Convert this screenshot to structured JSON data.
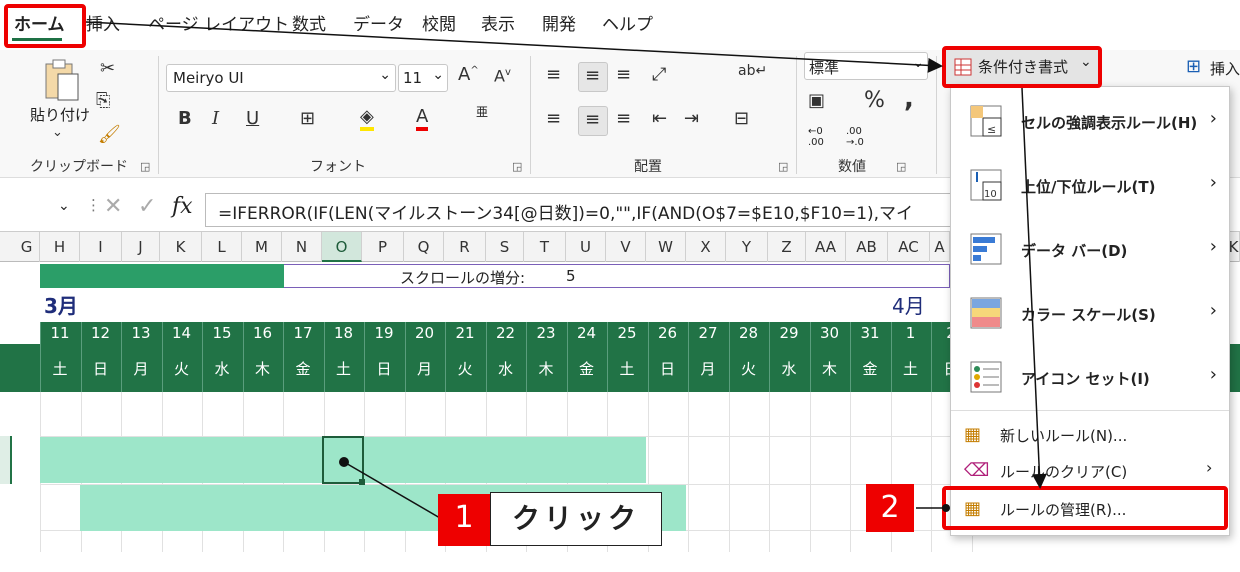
{
  "tabs": [
    "ホーム",
    "挿入",
    "ページ レイアウト",
    "数式",
    "データ",
    "校閲",
    "表示",
    "開発",
    "ヘルプ"
  ],
  "clipboard": {
    "paste_label": "貼り付け",
    "group_label": "クリップボード"
  },
  "font": {
    "name": "Meiryo UI",
    "size": "11",
    "group_label": "フォント",
    "ruby": "亜"
  },
  "alignment": {
    "group_label": "配置"
  },
  "number": {
    "format": "標準",
    "group_label": "数値",
    "percent": "%",
    "comma": ","
  },
  "cond_format": {
    "button_label": "条件付き書式"
  },
  "insert_label": "挿入",
  "formula": "=IFERROR(IF(LEN(マイルストーン34[@日数])=0,\"\",IF(AND(O$7=$E10,$F10=1),マイ",
  "columns": [
    "G",
    "H",
    "I",
    "J",
    "K",
    "L",
    "M",
    "N",
    "O",
    "P",
    "Q",
    "R",
    "S",
    "T",
    "U",
    "V",
    "W",
    "X",
    "Y",
    "Z",
    "AA",
    "AB",
    "AC",
    "A",
    "K"
  ],
  "sheet": {
    "scroll_label": "スクロールの増分:",
    "scroll_value": "5",
    "month1": "3月",
    "month2": "4月",
    "dates": [
      "11",
      "12",
      "13",
      "14",
      "15",
      "16",
      "17",
      "18",
      "19",
      "20",
      "21",
      "22",
      "23",
      "24",
      "25",
      "26",
      "27",
      "28",
      "29",
      "30",
      "31",
      "1",
      "2"
    ],
    "weekdays": [
      "土",
      "日",
      "月",
      "火",
      "水",
      "木",
      "金",
      "土",
      "日",
      "月",
      "火",
      "水",
      "木",
      "金",
      "土",
      "日",
      "月",
      "火",
      "水",
      "木",
      "金",
      "土",
      "日"
    ]
  },
  "menu": {
    "items": [
      {
        "label": "セルの強調表示ルール(H)"
      },
      {
        "label": "上位/下位ルール(T)"
      },
      {
        "label": "データ バー(D)"
      },
      {
        "label": "カラー スケール(S)"
      },
      {
        "label": "アイコン セット(I)"
      }
    ],
    "new_rule": "新しいルール(N)...",
    "clear_rule": "ルールのクリア(C)",
    "manage_rule": "ルールの管理(R)..."
  },
  "annotations": {
    "step1": "1",
    "step1_text": "クリック",
    "step2": "2"
  },
  "colors": {
    "accent_green": "#217346",
    "highlight": "#9de6c9",
    "red": "#ee0000"
  }
}
